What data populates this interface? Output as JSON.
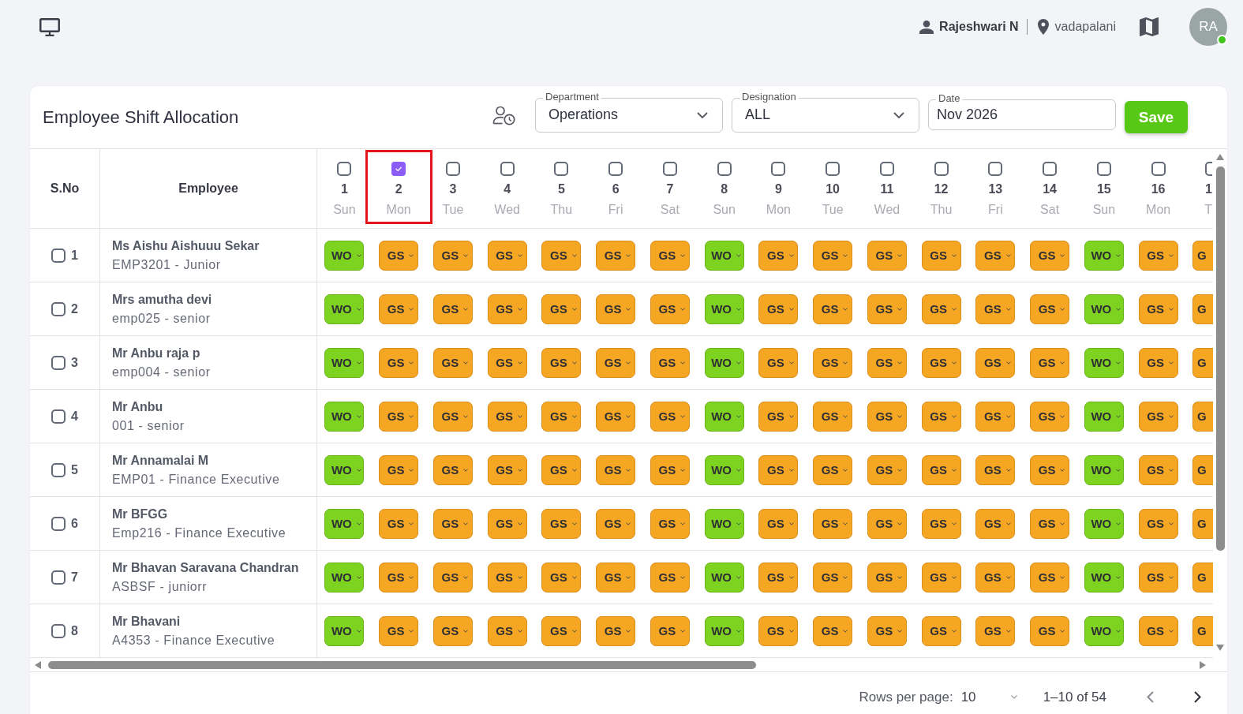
{
  "top_bar": {
    "user": "Rajeshwari N",
    "location": "vadapalani",
    "avatar": "RA",
    "online": true
  },
  "page": {
    "title": "Employee Shift Allocation",
    "filters": [
      {
        "kind": "select",
        "label": "Department",
        "value": "Operations"
      },
      {
        "kind": "select",
        "label": "Designation",
        "value": "ALL"
      },
      {
        "kind": "date",
        "label": "Date",
        "value": "Nov 2026"
      }
    ],
    "save_button": "Save"
  },
  "table": {
    "columns": [
      "S.No",
      "Employee"
    ],
    "days": [
      {
        "number": "1",
        "weekday": "Sun",
        "selected": false,
        "highlighted": false
      },
      {
        "number": "2",
        "weekday": "Mon",
        "selected": true,
        "highlighted": true
      },
      {
        "number": "3",
        "weekday": "Tue",
        "selected": false,
        "highlighted": false
      },
      {
        "number": "4",
        "weekday": "Wed",
        "selected": false,
        "highlighted": false
      },
      {
        "number": "5",
        "weekday": "Thu",
        "selected": false,
        "highlighted": false
      },
      {
        "number": "6",
        "weekday": "Fri",
        "selected": false,
        "highlighted": false
      },
      {
        "number": "7",
        "weekday": "Sat",
        "selected": false,
        "highlighted": false
      },
      {
        "number": "8",
        "weekday": "Sun",
        "selected": false,
        "highlighted": false
      },
      {
        "number": "9",
        "weekday": "Mon",
        "selected": false,
        "highlighted": false
      },
      {
        "number": "10",
        "weekday": "Tue",
        "selected": false,
        "highlighted": false
      },
      {
        "number": "11",
        "weekday": "Wed",
        "selected": false,
        "highlighted": false
      },
      {
        "number": "12",
        "weekday": "Thu",
        "selected": false,
        "highlighted": false
      },
      {
        "number": "13",
        "weekday": "Fri",
        "selected": false,
        "highlighted": false
      },
      {
        "number": "14",
        "weekday": "Sat",
        "selected": false,
        "highlighted": false
      },
      {
        "number": "15",
        "weekday": "Sun",
        "selected": false,
        "highlighted": false
      },
      {
        "number": "16",
        "weekday": "Mon",
        "selected": false,
        "highlighted": false
      },
      {
        "number": "1",
        "weekday": "T",
        "selected": false,
        "highlighted": false
      }
    ],
    "rows": [
      {
        "number": "1",
        "selected": false,
        "name": "Ms Aishu Aishuuu Sekar",
        "detail": "EMP3201 - Junior",
        "shifts": [
          {
            "label": "WO",
            "kind": "off"
          },
          {
            "label": "GS",
            "kind": "general"
          },
          {
            "label": "GS",
            "kind": "general"
          },
          {
            "label": "GS",
            "kind": "general"
          },
          {
            "label": "GS",
            "kind": "general"
          },
          {
            "label": "GS",
            "kind": "general"
          },
          {
            "label": "GS",
            "kind": "general"
          },
          {
            "label": "WO",
            "kind": "off"
          },
          {
            "label": "GS",
            "kind": "general"
          },
          {
            "label": "GS",
            "kind": "general"
          },
          {
            "label": "GS",
            "kind": "general"
          },
          {
            "label": "GS",
            "kind": "general"
          },
          {
            "label": "GS",
            "kind": "general"
          },
          {
            "label": "GS",
            "kind": "general"
          },
          {
            "label": "WO",
            "kind": "off"
          },
          {
            "label": "GS",
            "kind": "general"
          },
          {
            "label": "G",
            "kind": "general"
          }
        ]
      },
      {
        "number": "2",
        "selected": false,
        "name": "Mrs amutha devi",
        "detail": "emp025 - senior",
        "shifts": [
          {
            "label": "WO",
            "kind": "off"
          },
          {
            "label": "GS",
            "kind": "general"
          },
          {
            "label": "GS",
            "kind": "general"
          },
          {
            "label": "GS",
            "kind": "general"
          },
          {
            "label": "GS",
            "kind": "general"
          },
          {
            "label": "GS",
            "kind": "general"
          },
          {
            "label": "GS",
            "kind": "general"
          },
          {
            "label": "WO",
            "kind": "off"
          },
          {
            "label": "GS",
            "kind": "general"
          },
          {
            "label": "GS",
            "kind": "general"
          },
          {
            "label": "GS",
            "kind": "general"
          },
          {
            "label": "GS",
            "kind": "general"
          },
          {
            "label": "GS",
            "kind": "general"
          },
          {
            "label": "GS",
            "kind": "general"
          },
          {
            "label": "WO",
            "kind": "off"
          },
          {
            "label": "GS",
            "kind": "general"
          },
          {
            "label": "G",
            "kind": "general"
          }
        ]
      },
      {
        "number": "3",
        "selected": false,
        "name": "Mr Anbu raja p",
        "detail": "emp004 - senior",
        "shifts": [
          {
            "label": "WO",
            "kind": "off"
          },
          {
            "label": "GS",
            "kind": "general"
          },
          {
            "label": "GS",
            "kind": "general"
          },
          {
            "label": "GS",
            "kind": "general"
          },
          {
            "label": "GS",
            "kind": "general"
          },
          {
            "label": "GS",
            "kind": "general"
          },
          {
            "label": "GS",
            "kind": "general"
          },
          {
            "label": "WO",
            "kind": "off"
          },
          {
            "label": "GS",
            "kind": "general"
          },
          {
            "label": "GS",
            "kind": "general"
          },
          {
            "label": "GS",
            "kind": "general"
          },
          {
            "label": "GS",
            "kind": "general"
          },
          {
            "label": "GS",
            "kind": "general"
          },
          {
            "label": "GS",
            "kind": "general"
          },
          {
            "label": "WO",
            "kind": "off"
          },
          {
            "label": "GS",
            "kind": "general"
          },
          {
            "label": "G",
            "kind": "general"
          }
        ]
      },
      {
        "number": "4",
        "selected": false,
        "name": "Mr Anbu",
        "detail": "001 - senior",
        "shifts": [
          {
            "label": "WO",
            "kind": "off"
          },
          {
            "label": "GS",
            "kind": "general"
          },
          {
            "label": "GS",
            "kind": "general"
          },
          {
            "label": "GS",
            "kind": "general"
          },
          {
            "label": "GS",
            "kind": "general"
          },
          {
            "label": "GS",
            "kind": "general"
          },
          {
            "label": "GS",
            "kind": "general"
          },
          {
            "label": "WO",
            "kind": "off"
          },
          {
            "label": "GS",
            "kind": "general"
          },
          {
            "label": "GS",
            "kind": "general"
          },
          {
            "label": "GS",
            "kind": "general"
          },
          {
            "label": "GS",
            "kind": "general"
          },
          {
            "label": "GS",
            "kind": "general"
          },
          {
            "label": "GS",
            "kind": "general"
          },
          {
            "label": "WO",
            "kind": "off"
          },
          {
            "label": "GS",
            "kind": "general"
          },
          {
            "label": "G",
            "kind": "general"
          }
        ]
      },
      {
        "number": "5",
        "selected": false,
        "name": "Mr Annamalai M",
        "detail": "EMP01 - Finance Executive",
        "shifts": [
          {
            "label": "WO",
            "kind": "off"
          },
          {
            "label": "GS",
            "kind": "general"
          },
          {
            "label": "GS",
            "kind": "general"
          },
          {
            "label": "GS",
            "kind": "general"
          },
          {
            "label": "GS",
            "kind": "general"
          },
          {
            "label": "GS",
            "kind": "general"
          },
          {
            "label": "GS",
            "kind": "general"
          },
          {
            "label": "WO",
            "kind": "off"
          },
          {
            "label": "GS",
            "kind": "general"
          },
          {
            "label": "GS",
            "kind": "general"
          },
          {
            "label": "GS",
            "kind": "general"
          },
          {
            "label": "GS",
            "kind": "general"
          },
          {
            "label": "GS",
            "kind": "general"
          },
          {
            "label": "GS",
            "kind": "general"
          },
          {
            "label": "WO",
            "kind": "off"
          },
          {
            "label": "GS",
            "kind": "general"
          },
          {
            "label": "G",
            "kind": "general"
          }
        ]
      },
      {
        "number": "6",
        "selected": false,
        "name": "Mr BFGG",
        "detail": "Emp216 - Finance Executive",
        "shifts": [
          {
            "label": "WO",
            "kind": "off"
          },
          {
            "label": "GS",
            "kind": "general"
          },
          {
            "label": "GS",
            "kind": "general"
          },
          {
            "label": "GS",
            "kind": "general"
          },
          {
            "label": "GS",
            "kind": "general"
          },
          {
            "label": "GS",
            "kind": "general"
          },
          {
            "label": "GS",
            "kind": "general"
          },
          {
            "label": "WO",
            "kind": "off"
          },
          {
            "label": "GS",
            "kind": "general"
          },
          {
            "label": "GS",
            "kind": "general"
          },
          {
            "label": "GS",
            "kind": "general"
          },
          {
            "label": "GS",
            "kind": "general"
          },
          {
            "label": "GS",
            "kind": "general"
          },
          {
            "label": "GS",
            "kind": "general"
          },
          {
            "label": "WO",
            "kind": "off"
          },
          {
            "label": "GS",
            "kind": "general"
          },
          {
            "label": "G",
            "kind": "general"
          }
        ]
      },
      {
        "number": "7",
        "selected": false,
        "name": "Mr Bhavan Saravana Chandran",
        "detail": "ASBSF - juniorr",
        "shifts": [
          {
            "label": "WO",
            "kind": "off"
          },
          {
            "label": "GS",
            "kind": "general"
          },
          {
            "label": "GS",
            "kind": "general"
          },
          {
            "label": "GS",
            "kind": "general"
          },
          {
            "label": "GS",
            "kind": "general"
          },
          {
            "label": "GS",
            "kind": "general"
          },
          {
            "label": "GS",
            "kind": "general"
          },
          {
            "label": "WO",
            "kind": "off"
          },
          {
            "label": "GS",
            "kind": "general"
          },
          {
            "label": "GS",
            "kind": "general"
          },
          {
            "label": "GS",
            "kind": "general"
          },
          {
            "label": "GS",
            "kind": "general"
          },
          {
            "label": "GS",
            "kind": "general"
          },
          {
            "label": "GS",
            "kind": "general"
          },
          {
            "label": "WO",
            "kind": "off"
          },
          {
            "label": "GS",
            "kind": "general"
          },
          {
            "label": "G",
            "kind": "general"
          }
        ]
      },
      {
        "number": "8",
        "selected": false,
        "name": "Mr Bhavani",
        "detail": "A4353 - Finance Executive",
        "shifts": [
          {
            "label": "WO",
            "kind": "off"
          },
          {
            "label": "GS",
            "kind": "general"
          },
          {
            "label": "GS",
            "kind": "general"
          },
          {
            "label": "GS",
            "kind": "general"
          },
          {
            "label": "GS",
            "kind": "general"
          },
          {
            "label": "GS",
            "kind": "general"
          },
          {
            "label": "GS",
            "kind": "general"
          },
          {
            "label": "WO",
            "kind": "off"
          },
          {
            "label": "GS",
            "kind": "general"
          },
          {
            "label": "GS",
            "kind": "general"
          },
          {
            "label": "GS",
            "kind": "general"
          },
          {
            "label": "GS",
            "kind": "general"
          },
          {
            "label": "GS",
            "kind": "general"
          },
          {
            "label": "GS",
            "kind": "general"
          },
          {
            "label": "WO",
            "kind": "off"
          },
          {
            "label": "GS",
            "kind": "general"
          },
          {
            "label": "G",
            "kind": "general"
          }
        ]
      }
    ]
  },
  "pagination": {
    "rows_per_page_label": "Rows per page:",
    "rows_per_page": "10",
    "range": "1–10 of 54",
    "previous": {
      "disabled": true
    },
    "next": {
      "disabled": false
    }
  }
}
